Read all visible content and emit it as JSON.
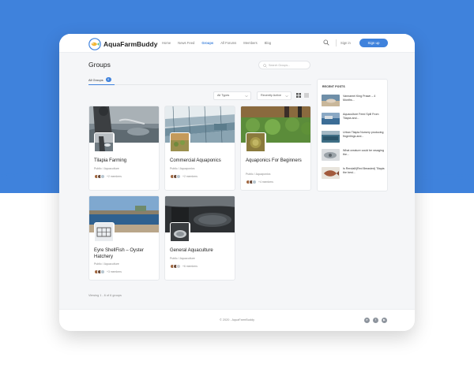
{
  "brand": {
    "name": "AquaFarmBuddy"
  },
  "nav": {
    "items": [
      {
        "label": "Home",
        "active": false
      },
      {
        "label": "News Feed",
        "active": false
      },
      {
        "label": "Groups",
        "active": true
      },
      {
        "label": "All Forums",
        "active": false
      },
      {
        "label": "Members",
        "active": false
      },
      {
        "label": "Blog",
        "active": false
      }
    ],
    "signin": "Sign in",
    "signup": "Sign up"
  },
  "page": {
    "title": "Groups",
    "search_placeholder": "Search Groups...",
    "tab_label": "All Groups",
    "tab_count": "6",
    "filter_type": "All Types",
    "filter_sort": "Recently Active",
    "viewing": "Viewing 1 - 6 of 6 groups"
  },
  "groups": [
    {
      "name": "Tilapia Farming",
      "meta": "Public / Aquaculture",
      "members": "+2 members"
    },
    {
      "name": "Commercial Aquaponics",
      "meta": "Public / Aquaponics",
      "members": "+2 members"
    },
    {
      "name": "Aquaponics For Beginners",
      "meta": "Public / Aquaponics",
      "members": "+4 members"
    },
    {
      "name": "Eyre ShellFish – Oyster Hatchery",
      "meta": "Public / Aquaculture",
      "members": "+3 members"
    },
    {
      "name": "General Aquaculture",
      "meta": "Public / Aquaculture",
      "members": "+6 members"
    }
  ],
  "sidebar": {
    "title": "RECENT POSTS",
    "posts": [
      {
        "text": "Vannamei King Prawn – 4 Months..."
      },
      {
        "text": "Aquaculture Feed Spill From Tilapia and..."
      },
      {
        "text": "Urban Tilapia Nursery producing fingerlings and..."
      },
      {
        "text": "What creature could be ravaging the..."
      },
      {
        "text": "Is Rendalli(Red Breasted) Tilapia the best..."
      }
    ]
  },
  "footer": {
    "copyright": "© 2020 - AquaFarmBuddy"
  },
  "colors": {
    "accent": "#3f82dc",
    "background_blue": "#3f82dc"
  }
}
